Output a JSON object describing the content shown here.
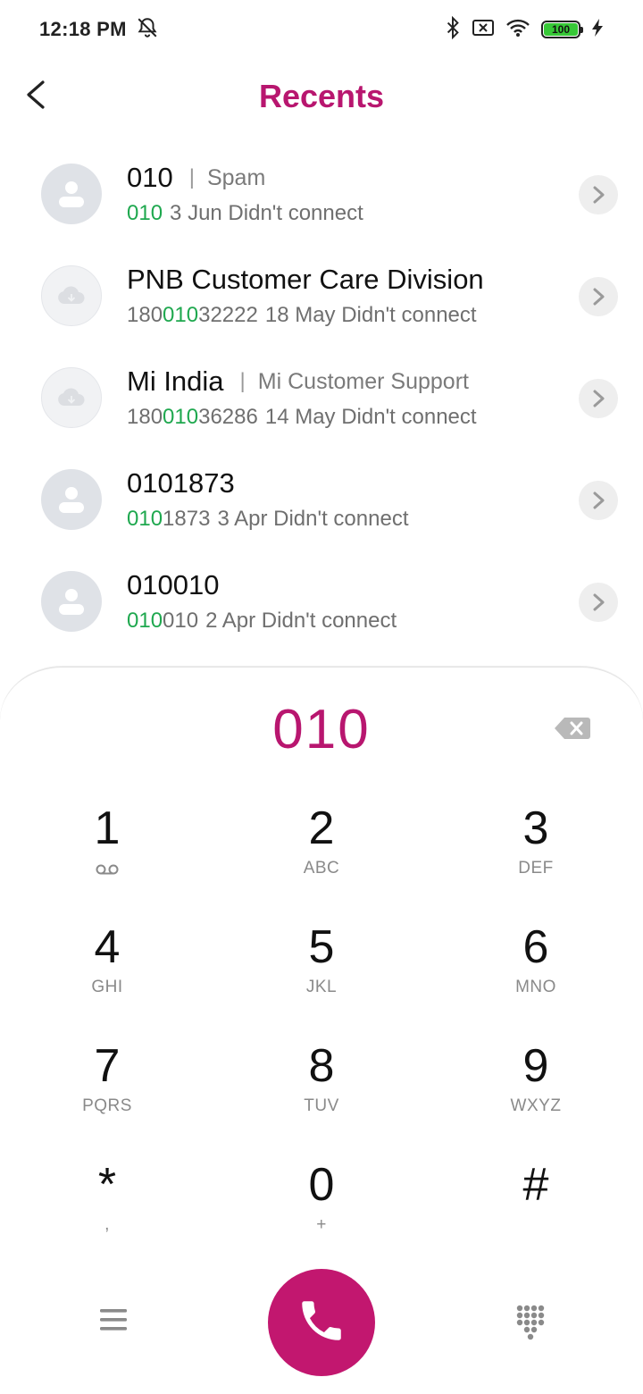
{
  "status_bar": {
    "time": "12:18 PM",
    "battery": "100"
  },
  "header": {
    "title": "Recents"
  },
  "recents": [
    {
      "name_parts": [
        {
          "t": "010",
          "hl": false
        }
      ],
      "tag": "Spam",
      "number_parts": [
        {
          "t": "010",
          "hl": true
        }
      ],
      "meta": "3 Jun Didn't connect",
      "avatar": "person"
    },
    {
      "name_parts": [
        {
          "t": "PNB Customer Care Division",
          "hl": false
        }
      ],
      "tag": "",
      "number_parts": [
        {
          "t": "180",
          "hl": false
        },
        {
          "t": "010",
          "hl": true
        },
        {
          "t": "32222",
          "hl": false
        }
      ],
      "meta": "18 May Didn't connect",
      "avatar": "cloud"
    },
    {
      "name_parts": [
        {
          "t": "Mi India",
          "hl": false
        }
      ],
      "tag": "Mi Customer Support",
      "number_parts": [
        {
          "t": "180",
          "hl": false
        },
        {
          "t": "010",
          "hl": true
        },
        {
          "t": "36286",
          "hl": false
        }
      ],
      "meta": "14 May Didn't connect",
      "avatar": "cloud"
    },
    {
      "name_parts": [
        {
          "t": "0101873",
          "hl": false
        }
      ],
      "tag": "",
      "number_parts": [
        {
          "t": "010",
          "hl": true
        },
        {
          "t": "1873",
          "hl": false
        }
      ],
      "meta": "3 Apr Didn't connect",
      "avatar": "person"
    },
    {
      "name_parts": [
        {
          "t": "010010",
          "hl": false
        }
      ],
      "tag": "",
      "number_parts": [
        {
          "t": "010",
          "hl": true
        },
        {
          "t": "010",
          "hl": false
        }
      ],
      "meta": "2 Apr Didn't connect",
      "avatar": "person"
    }
  ],
  "dialpad": {
    "input_value": "010",
    "keys": [
      [
        {
          "d": "1",
          "s": "voicemail-icon"
        },
        {
          "d": "2",
          "s": "ABC"
        },
        {
          "d": "3",
          "s": "DEF"
        }
      ],
      [
        {
          "d": "4",
          "s": "GHI"
        },
        {
          "d": "5",
          "s": "JKL"
        },
        {
          "d": "6",
          "s": "MNO"
        }
      ],
      [
        {
          "d": "7",
          "s": "PQRS"
        },
        {
          "d": "8",
          "s": "TUV"
        },
        {
          "d": "9",
          "s": "WXYZ"
        }
      ],
      [
        {
          "d": "*",
          "s": ","
        },
        {
          "d": "0",
          "s": "+"
        },
        {
          "d": "#",
          "s": ""
        }
      ]
    ]
  },
  "colors": {
    "accent": "#b8166f",
    "call_button": "#c2176f",
    "match_highlight": "#1fa84f"
  },
  "icons": {
    "back": "chevron-left-icon",
    "call": "phone-icon",
    "menu": "menu-icon",
    "keypad": "keypad-grid-icon",
    "backspace": "backspace-icon"
  }
}
